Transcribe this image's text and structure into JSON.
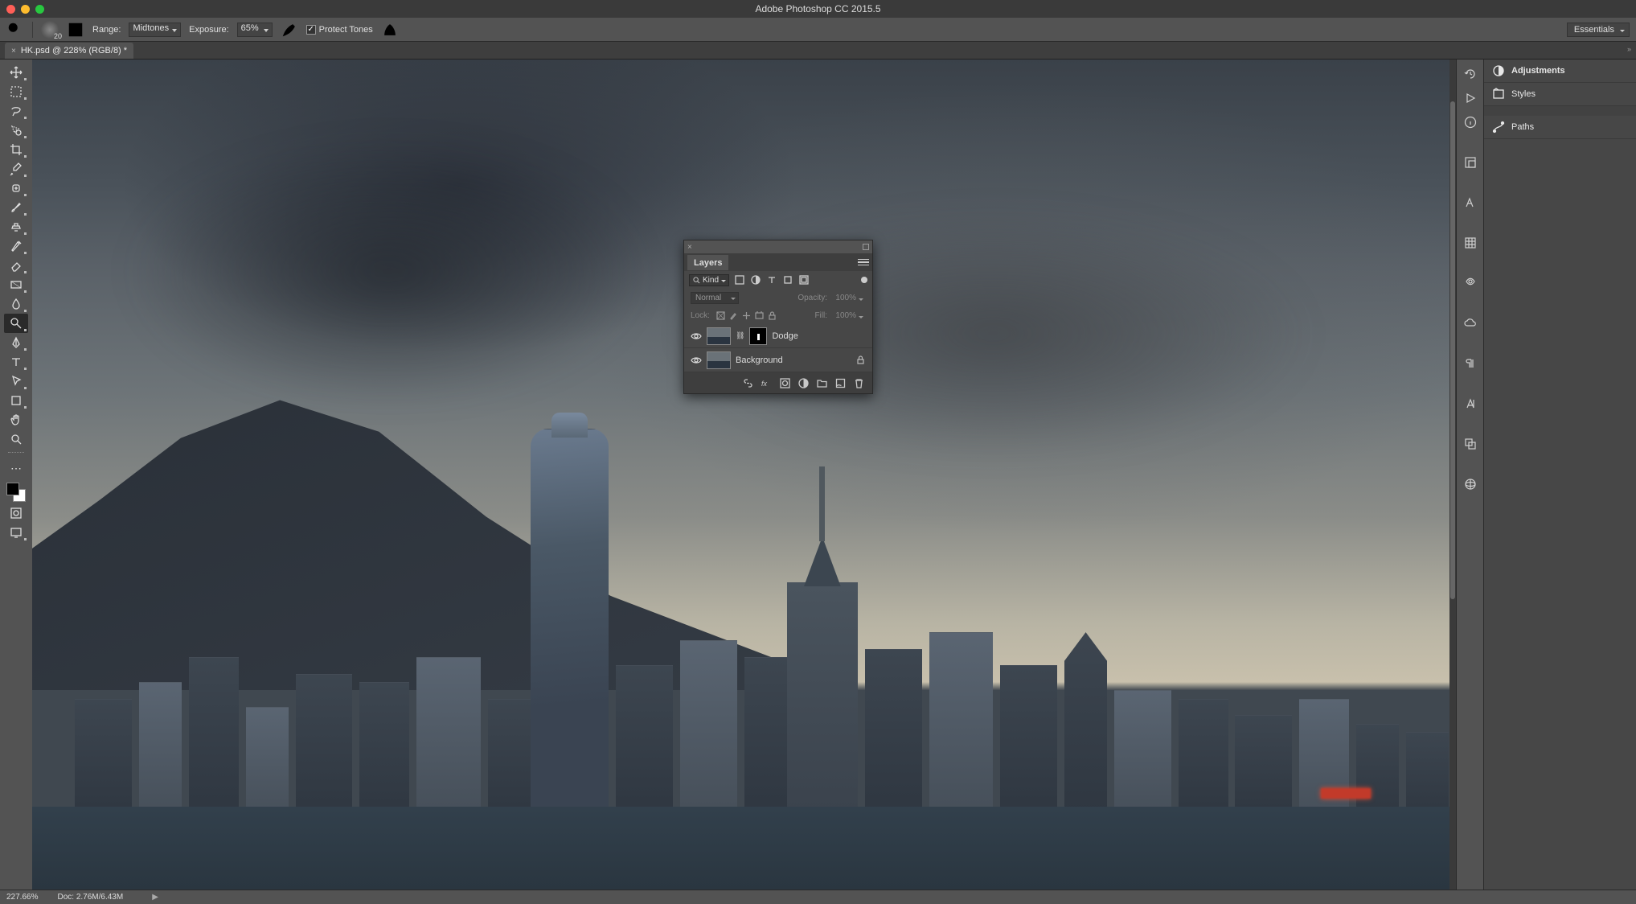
{
  "app_title": "Adobe Photoshop CC 2015.5",
  "options_bar": {
    "brush_size": "20",
    "range_label": "Range:",
    "range_value": "Midtones",
    "exposure_label": "Exposure:",
    "exposure_value": "65%",
    "protect_tones_label": "Protect Tones",
    "protect_tones_checked": true,
    "workspace": "Essentials"
  },
  "document_tab": {
    "title": "HK.psd @ 228% (RGB/8) *"
  },
  "right_panel": {
    "adjustments": "Adjustments",
    "styles": "Styles",
    "paths": "Paths"
  },
  "layers_panel": {
    "title": "Layers",
    "filter_kind": "Kind",
    "blend_mode": "Normal",
    "opacity_label": "Opacity:",
    "opacity_value": "100%",
    "lock_label": "Lock:",
    "fill_label": "Fill:",
    "fill_value": "100%",
    "layers": [
      {
        "name": "Dodge",
        "visible": true,
        "has_mask": true,
        "locked": false
      },
      {
        "name": "Background",
        "visible": true,
        "has_mask": false,
        "locked": true
      }
    ]
  },
  "status_bar": {
    "zoom": "227.66%",
    "doc_info": "Doc: 2.76M/6.43M"
  }
}
